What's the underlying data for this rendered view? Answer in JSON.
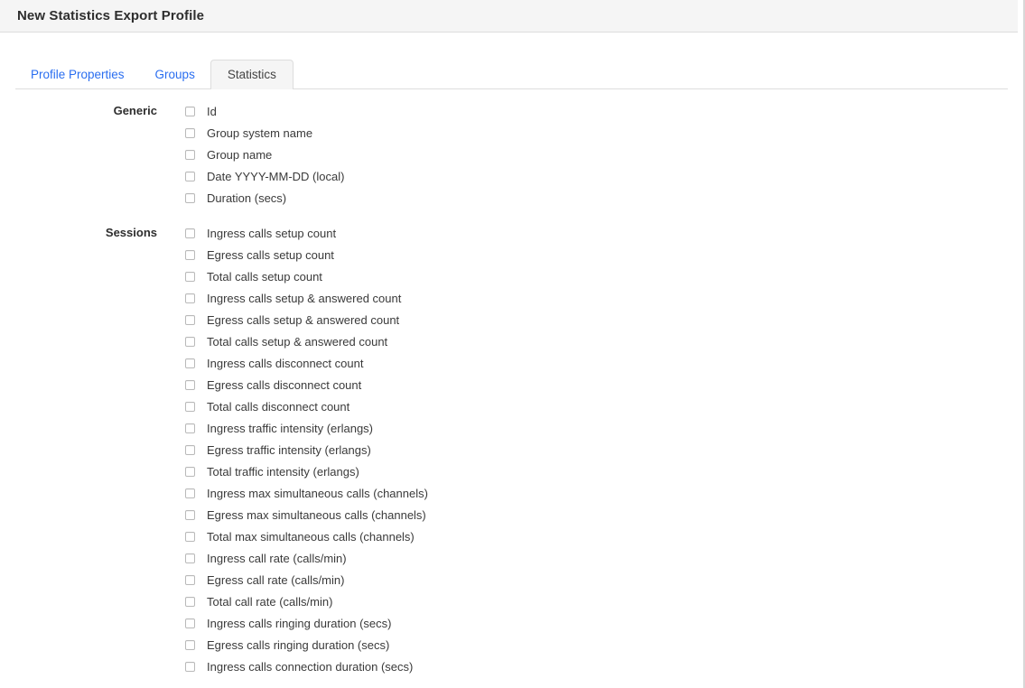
{
  "window": {
    "title": "New Statistics Export Profile"
  },
  "tabs": [
    {
      "label": "Profile Properties",
      "active": false
    },
    {
      "label": "Groups",
      "active": false
    },
    {
      "label": "Statistics",
      "active": true
    }
  ],
  "sections": [
    {
      "label": "Generic",
      "items": [
        {
          "label": "Id",
          "checked": false
        },
        {
          "label": "Group system name",
          "checked": false
        },
        {
          "label": "Group name",
          "checked": false
        },
        {
          "label": "Date YYYY-MM-DD (local)",
          "checked": false
        },
        {
          "label": "Duration (secs)",
          "checked": false
        }
      ]
    },
    {
      "label": "Sessions",
      "items": [
        {
          "label": "Ingress calls setup count",
          "checked": false
        },
        {
          "label": "Egress calls setup count",
          "checked": false
        },
        {
          "label": "Total calls setup count",
          "checked": false
        },
        {
          "label": "Ingress calls setup & answered count",
          "checked": false
        },
        {
          "label": "Egress calls setup & answered count",
          "checked": false
        },
        {
          "label": "Total calls setup & answered count",
          "checked": false
        },
        {
          "label": "Ingress calls disconnect count",
          "checked": false
        },
        {
          "label": "Egress calls disconnect count",
          "checked": false
        },
        {
          "label": "Total calls disconnect count",
          "checked": false
        },
        {
          "label": "Ingress traffic intensity (erlangs)",
          "checked": false
        },
        {
          "label": "Egress traffic intensity (erlangs)",
          "checked": false
        },
        {
          "label": "Total traffic intensity (erlangs)",
          "checked": false
        },
        {
          "label": "Ingress max simultaneous calls (channels)",
          "checked": false
        },
        {
          "label": "Egress max simultaneous calls (channels)",
          "checked": false
        },
        {
          "label": "Total max simultaneous calls (channels)",
          "checked": false
        },
        {
          "label": "Ingress call rate (calls/min)",
          "checked": false
        },
        {
          "label": "Egress call rate (calls/min)",
          "checked": false
        },
        {
          "label": "Total call rate (calls/min)",
          "checked": false
        },
        {
          "label": "Ingress calls ringing duration (secs)",
          "checked": false
        },
        {
          "label": "Egress calls ringing duration (secs)",
          "checked": false
        },
        {
          "label": "Ingress calls connection duration (secs)",
          "checked": false
        }
      ]
    }
  ],
  "colors": {
    "link": "#2a6ef0",
    "titlebar_bg": "#f5f5f5",
    "border": "#dddddd",
    "text": "#333333"
  }
}
